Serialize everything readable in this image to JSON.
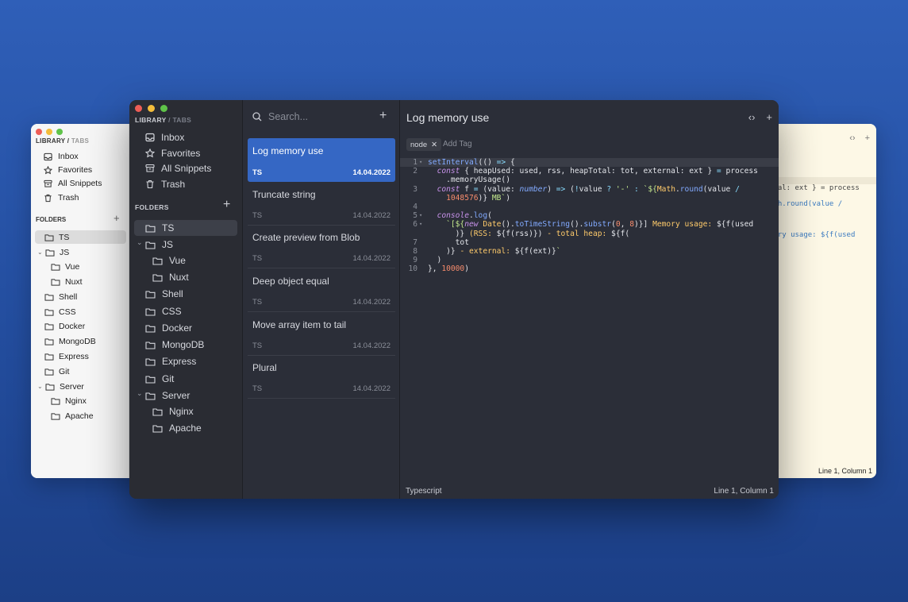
{
  "back_window": {
    "header_library": "LIBRARY",
    "header_sep": "/",
    "header_tabs": "TABS",
    "nav": [
      {
        "label": "Inbox",
        "icon": "inbox-icon"
      },
      {
        "label": "Favorites",
        "icon": "star-icon"
      },
      {
        "label": "All Snippets",
        "icon": "archive-icon"
      },
      {
        "label": "Trash",
        "icon": "trash-icon"
      }
    ],
    "folders_label": "FOLDERS",
    "folders": [
      "TS",
      "JS",
      "Vue",
      "Nuxt",
      "Shell",
      "CSS",
      "Docker",
      "MongoDB",
      "Express",
      "Git",
      "Server",
      "Nginx",
      "Apache"
    ],
    "code_fragments": [
      "rnal: ext } = process",
      "ath.round(value /",
      "mory usage: ${f(used"
    ],
    "status": "Line 1, Column 1"
  },
  "header": {
    "library": "LIBRARY",
    "sep": "/",
    "tabs": "TABS"
  },
  "nav": [
    {
      "label": "Inbox",
      "icon": "inbox-icon"
    },
    {
      "label": "Favorites",
      "icon": "star-icon"
    },
    {
      "label": "All Snippets",
      "icon": "archive-icon"
    },
    {
      "label": "Trash",
      "icon": "trash-icon"
    }
  ],
  "folders_label": "FOLDERS",
  "folders": [
    {
      "label": "TS",
      "active": true
    },
    {
      "label": "JS",
      "expanded": true
    },
    {
      "label": "Vue",
      "child": true
    },
    {
      "label": "Nuxt",
      "child": true
    },
    {
      "label": "Shell"
    },
    {
      "label": "CSS"
    },
    {
      "label": "Docker"
    },
    {
      "label": "MongoDB"
    },
    {
      "label": "Express"
    },
    {
      "label": "Git"
    },
    {
      "label": "Server",
      "expanded": true
    },
    {
      "label": "Nginx",
      "child": true
    },
    {
      "label": "Apache",
      "child": true
    }
  ],
  "search": {
    "placeholder": "Search..."
  },
  "snippets": [
    {
      "title": "Log memory use",
      "lang": "TS",
      "date": "14.04.2022",
      "active": true
    },
    {
      "title": "Truncate string",
      "lang": "TS",
      "date": "14.04.2022"
    },
    {
      "title": "Create preview from Blob",
      "lang": "TS",
      "date": "14.04.2022"
    },
    {
      "title": "Deep object equal",
      "lang": "TS",
      "date": "14.04.2022"
    },
    {
      "title": "Move array item to tail",
      "lang": "TS",
      "date": "14.04.2022"
    },
    {
      "title": "Plural",
      "lang": "TS",
      "date": "14.04.2022"
    }
  ],
  "editor": {
    "title": "Log memory use",
    "tag": "node",
    "add_tag": "Add Tag",
    "language": "Typescript",
    "cursor": "Line 1, Column 1",
    "code_lines": [
      "setInterval(() => {",
      "  const { heapUsed: used, rss, heapTotal: tot, external: ext } = process",
      "    .memoryUsage()",
      "  const f = (value: number) => (!value ? '-' : `${Math.round(value /",
      "    1048576)} MB`)",
      "",
      "  console.log(",
      "    `[${new Date().toTimeString().substr(0, 8)}] Memory usage: ${f(used",
      "      )} (RSS: ${f(rss)}) - total heap: ${f(",
      "      tot",
      "    )} - external: ${f(ext)}`",
      "  )",
      "}, 10000)"
    ],
    "line_numbers": [
      "1",
      "2",
      "",
      "3",
      "",
      "4",
      "5",
      "6",
      "",
      "7",
      "8",
      "9",
      "10"
    ]
  }
}
